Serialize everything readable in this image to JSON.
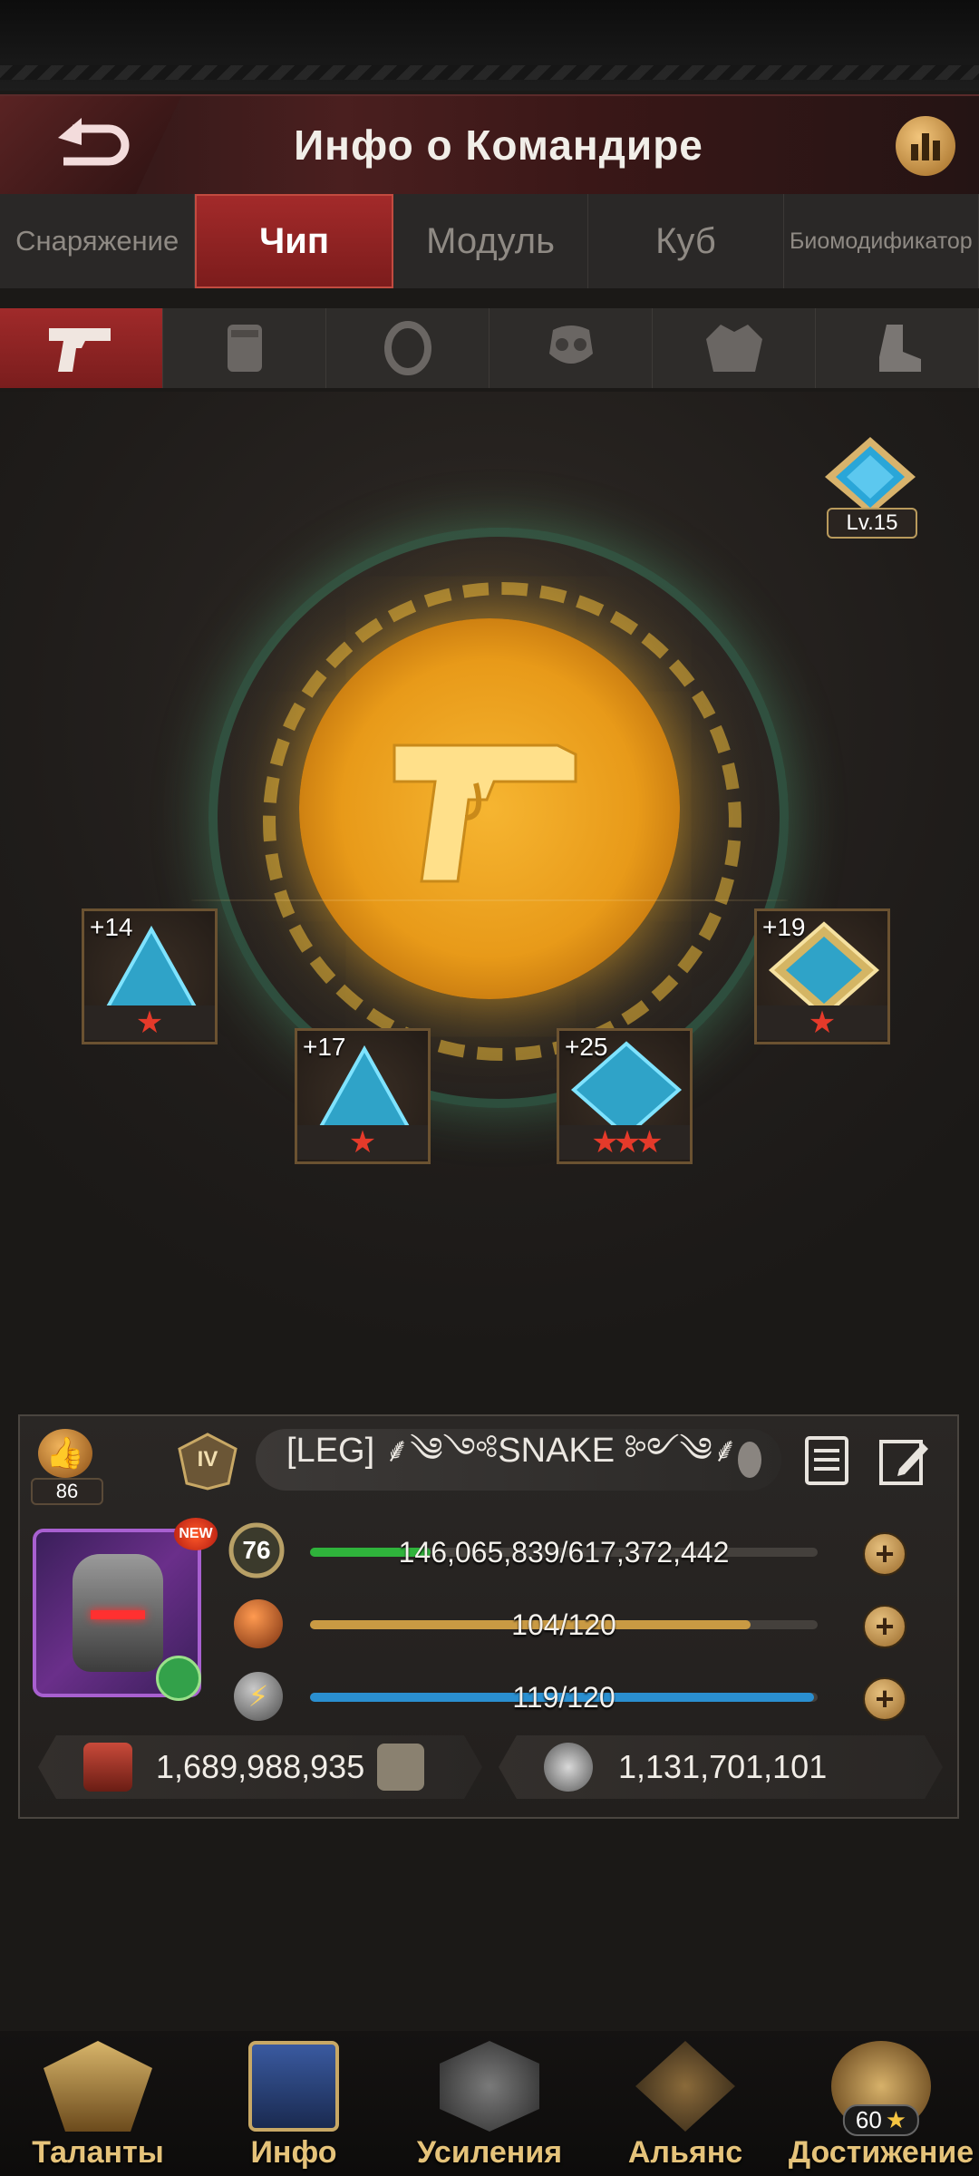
{
  "header": {
    "title": "Инфо о Командире"
  },
  "tabs": [
    "Снаряжение",
    "Чип",
    "Модуль",
    "Куб",
    "Биомодификатор"
  ],
  "chip_level": "Lv.15",
  "chips": [
    {
      "bonus": "+14",
      "stars": 1
    },
    {
      "bonus": "+17",
      "stars": 1
    },
    {
      "bonus": "+25",
      "stars": 3
    },
    {
      "bonus": "+19",
      "stars": 1
    }
  ],
  "profile": {
    "thumbs_count": "86",
    "rank": "IV",
    "name": "[LEG] ⸙༄༺SNAKE ༻༄⸙",
    "new_badge": "NEW",
    "level": "76",
    "exp": "146,065,839/617,372,442",
    "exp_fraction": 0.2366,
    "stamina": "104/120",
    "stamina_fraction": 0.8667,
    "energy": "119/120",
    "energy_fraction": 0.9917,
    "power": "1,689,988,935",
    "kills": "1,131,701,101"
  },
  "nav": {
    "talents": "Таланты",
    "info": "Инфо",
    "boosts": "Усиления",
    "alliance": "Альянс",
    "achievement": "Достижение",
    "achievement_badge": "60"
  },
  "colors": {
    "accent_red": "#a32a2a",
    "gold": "#e5c37a",
    "exp_bar": "#2fb33b",
    "stamina_bar": "#c99a43",
    "energy_bar": "#2a8fd0"
  }
}
